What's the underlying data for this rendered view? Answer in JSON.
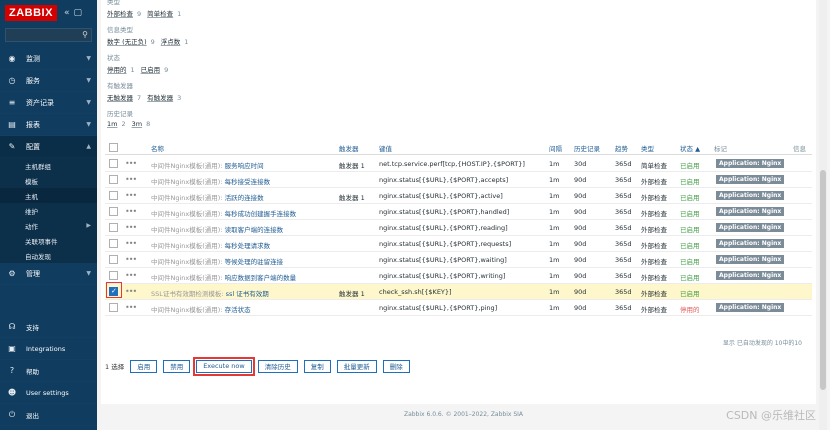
{
  "sidebar": {
    "logo": "ZABBIX",
    "items": [
      {
        "icon": "eye-icon",
        "glyph": "◉",
        "label": "监测"
      },
      {
        "icon": "clock-icon",
        "glyph": "◷",
        "label": "服务"
      },
      {
        "icon": "list-icon",
        "glyph": "≡",
        "label": "资产记录"
      },
      {
        "icon": "chart-icon",
        "glyph": "▤",
        "label": "报表"
      },
      {
        "icon": "wrench-icon",
        "glyph": "✎",
        "label": "配置"
      }
    ],
    "config_sub": [
      "主机群组",
      "模板",
      "主机",
      "维护",
      "动作",
      "关联项事件",
      "自动发现"
    ],
    "admin": {
      "icon": "gear-icon",
      "glyph": "⚙",
      "label": "管理"
    },
    "bottom": [
      {
        "icon": "headset-icon",
        "glyph": "☊",
        "label": "支持"
      },
      {
        "icon": "integrations-icon",
        "glyph": "▣",
        "label": "Integrations"
      },
      {
        "icon": "help-icon",
        "glyph": "?",
        "label": "帮助"
      },
      {
        "icon": "user-icon",
        "glyph": "☻",
        "label": "User settings"
      },
      {
        "icon": "power-icon",
        "glyph": "⏻",
        "label": "退出"
      }
    ]
  },
  "filters": {
    "type": {
      "label": "类型",
      "values": [
        {
          "name": "外部检查",
          "count": "9"
        },
        {
          "name": "简单检查",
          "count": "1"
        }
      ]
    },
    "info_type": {
      "label": "信息类型",
      "values": [
        {
          "name": "数字 (无正负)",
          "count": "9"
        },
        {
          "name": "浮点数",
          "count": "1"
        }
      ]
    },
    "state": {
      "label": "状态",
      "values": [
        {
          "name": "停用的",
          "count": "1"
        },
        {
          "name": "已启用",
          "count": "9"
        }
      ]
    },
    "triggers": {
      "label": "有触发器",
      "values": [
        {
          "name": "无触发器",
          "count": "7"
        },
        {
          "name": "有触发器",
          "count": "3"
        }
      ]
    },
    "history": {
      "label": "历史记录",
      "values": [
        {
          "name": "1m",
          "count": "2"
        },
        {
          "name": "3m",
          "count": "8"
        }
      ]
    }
  },
  "table": {
    "headers": {
      "name": "名称",
      "triggers": "触发器",
      "key": "键值",
      "interval": "间隔",
      "history": "历史记录",
      "trends": "趋势",
      "type": "类型",
      "status": "状态 ▲",
      "tags": "标记",
      "info": "信息"
    },
    "rows": [
      {
        "template": "中间件Nginx模板(通用):",
        "name": "服务响应时间",
        "triggers": "触发器 1",
        "key": "net.tcp.service.perf[tcp,{HOST.IP},{$PORT}]",
        "interval": "1m",
        "history": "30d",
        "trends": "365d",
        "type": "简单检查",
        "status": "已启用",
        "status_color": "green",
        "tag": "Application: Nginx"
      },
      {
        "template": "中间件Nginx模板(通用):",
        "name": "每秒接受连接数",
        "triggers": "",
        "key": "nginx.status[{$URL},{$PORT},accepts]",
        "interval": "1m",
        "history": "90d",
        "trends": "365d",
        "type": "外部检查",
        "status": "已启用",
        "status_color": "green",
        "tag": "Application: Nginx"
      },
      {
        "template": "中间件Nginx模板(通用):",
        "name": "活跃的连接数",
        "triggers": "触发器 1",
        "key": "nginx.status[{$URL},{$PORT},active]",
        "interval": "1m",
        "history": "90d",
        "trends": "365d",
        "type": "外部检查",
        "status": "已启用",
        "status_color": "green",
        "tag": "Application: Nginx"
      },
      {
        "template": "中间件Nginx模板(通用):",
        "name": "每秒成功创建握手连接数",
        "triggers": "",
        "key": "nginx.status[{$URL},{$PORT},handled]",
        "interval": "1m",
        "history": "90d",
        "trends": "365d",
        "type": "外部检查",
        "status": "已启用",
        "status_color": "green",
        "tag": "Application: Nginx"
      },
      {
        "template": "中间件Nginx模板(通用):",
        "name": "读取客户端的连接数",
        "triggers": "",
        "key": "nginx.status[{$URL},{$PORT},reading]",
        "interval": "1m",
        "history": "90d",
        "trends": "365d",
        "type": "外部检查",
        "status": "已启用",
        "status_color": "green",
        "tag": "Application: Nginx"
      },
      {
        "template": "中间件Nginx模板(通用):",
        "name": "每秒处理请求数",
        "triggers": "",
        "key": "nginx.status[{$URL},{$PORT},requests]",
        "interval": "1m",
        "history": "90d",
        "trends": "365d",
        "type": "外部检查",
        "status": "已启用",
        "status_color": "green",
        "tag": "Application: Nginx"
      },
      {
        "template": "中间件Nginx模板(通用):",
        "name": "等候处理的驻留连接",
        "triggers": "",
        "key": "nginx.status[{$URL},{$PORT},waiting]",
        "interval": "1m",
        "history": "90d",
        "trends": "365d",
        "type": "外部检查",
        "status": "已启用",
        "status_color": "green",
        "tag": "Application: Nginx"
      },
      {
        "template": "中间件Nginx模板(通用):",
        "name": "响应数据到客户端的数量",
        "triggers": "",
        "key": "nginx.status[{$URL},{$PORT},writing]",
        "interval": "1m",
        "history": "90d",
        "trends": "365d",
        "type": "外部检查",
        "status": "已启用",
        "status_color": "green",
        "tag": "Application: Nginx"
      },
      {
        "template": "SSL证书有效期检测模板:",
        "name": "ssl 证书有效期",
        "triggers": "触发器 1",
        "key": "check_ssh.sh[{$KEY}]",
        "interval": "1m",
        "history": "90d",
        "trends": "365d",
        "type": "外部检查",
        "status": "已启用",
        "status_color": "green",
        "tag": "",
        "checked": true
      },
      {
        "template": "中间件Nginx模板(通用):",
        "name": "存活状态",
        "triggers": "",
        "key": "nginx.status[{$URL},{$PORT},ping]",
        "interval": "1m",
        "history": "90d",
        "trends": "365d",
        "type": "外部检查",
        "status": "停用的",
        "status_color": "red",
        "tag": "Application: Nginx"
      }
    ],
    "footer_note": "显示 已自动发现的 10中的10"
  },
  "actions": {
    "selected": "1 选择",
    "buttons": [
      "启用",
      "禁用",
      "Execute now",
      "清除历史",
      "复制",
      "批量更新",
      "删除"
    ]
  },
  "copyright": "Zabbix 6.0.6. © 2001–2022, Zabbix SIA",
  "watermark": "CSDN @乐维社区",
  "colors": {
    "sidebar": "#0f3c5f",
    "logo": "#d40000",
    "link": "#1f5c93",
    "enabled": "#429e47",
    "disabled": "#e45959",
    "highlight": "#fff7cc",
    "annotation": "#e53935"
  }
}
